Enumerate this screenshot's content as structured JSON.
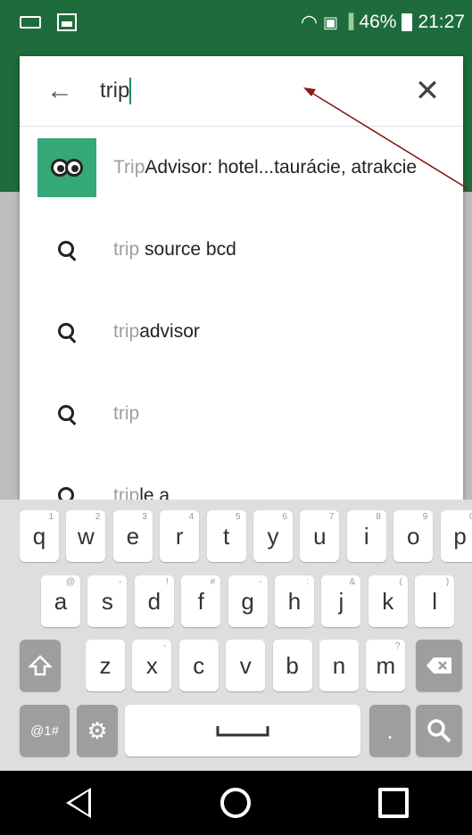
{
  "status_bar": {
    "battery": "46%",
    "time": "21:27"
  },
  "search": {
    "query": "trip",
    "back_icon": "arrow-left-icon",
    "clear_icon": "close-icon"
  },
  "suggestions": [
    {
      "icon": "tripadvisor-app-icon",
      "dim": "Trip",
      "bold": "Advisor: hotel...taurácie, atrakcie"
    },
    {
      "icon": "search-icon",
      "dim": "trip",
      "bold": " source bcd"
    },
    {
      "icon": "search-icon",
      "dim": "trip",
      "bold": "advisor"
    },
    {
      "icon": "search-icon",
      "dim": "trip",
      "bold": ""
    },
    {
      "icon": "search-icon",
      "dim": "trip",
      "bold": "le a"
    }
  ],
  "keyboard": {
    "row1": [
      {
        "label": "q",
        "hint": "1"
      },
      {
        "label": "w",
        "hint": "2"
      },
      {
        "label": "e",
        "hint": "3"
      },
      {
        "label": "r",
        "hint": "4"
      },
      {
        "label": "t",
        "hint": "5"
      },
      {
        "label": "y",
        "hint": "6"
      },
      {
        "label": "u",
        "hint": "7"
      },
      {
        "label": "i",
        "hint": "8"
      },
      {
        "label": "o",
        "hint": "9"
      },
      {
        "label": "p",
        "hint": "0"
      }
    ],
    "row2": [
      {
        "label": "a",
        "hint": "@"
      },
      {
        "label": "s",
        "hint": "-"
      },
      {
        "label": "d",
        "hint": "!"
      },
      {
        "label": "f",
        "hint": "#"
      },
      {
        "label": "g",
        "hint": "-"
      },
      {
        "label": "h",
        "hint": ":"
      },
      {
        "label": "j",
        "hint": "&"
      },
      {
        "label": "k",
        "hint": "("
      },
      {
        "label": "l",
        "hint": ")"
      }
    ],
    "row3": [
      {
        "label": "z",
        "hint": ""
      },
      {
        "label": "x",
        "hint": "-"
      },
      {
        "label": "c",
        "hint": ""
      },
      {
        "label": "v",
        "hint": ""
      },
      {
        "label": "b",
        "hint": ""
      },
      {
        "label": "n",
        "hint": ""
      },
      {
        "label": "m",
        "hint": "?"
      }
    ],
    "symbols_label": "@1#",
    "space_label": "",
    "period_label": "."
  },
  "nav": {
    "back": "back-triangle-icon",
    "home": "home-circle-icon",
    "recents": "recents-square-icon"
  },
  "colors": {
    "status_bar": "#1e6b3c",
    "app_thumb": "#34a877",
    "caret": "#1e8e5a",
    "annotation": "#8b1a1a"
  }
}
